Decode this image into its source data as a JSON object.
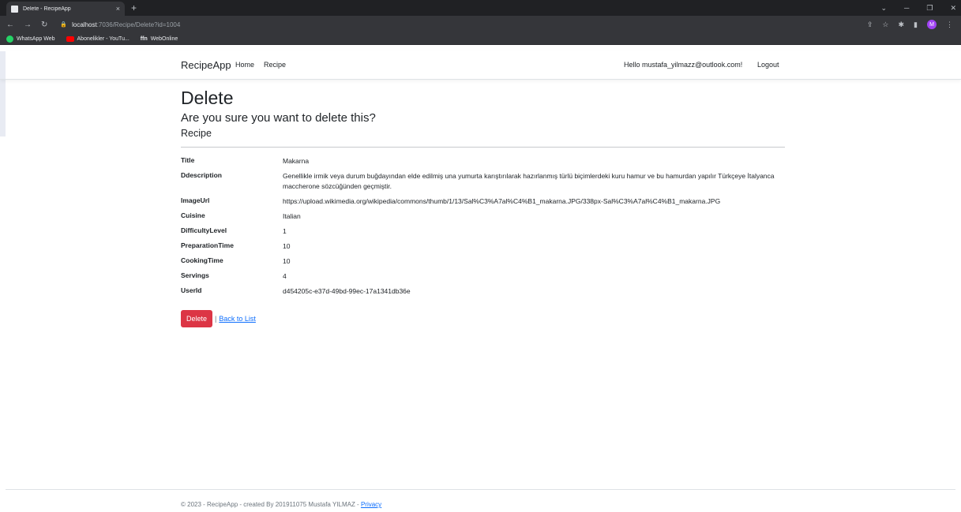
{
  "browser": {
    "tab_title": "Delete - RecipeApp",
    "tab_close": "×",
    "new_tab": "+",
    "url_host": "localhost",
    "url_path": ":7036/Recipe/Delete?id=1004",
    "bookmarks": [
      "WhatsApp Web",
      "Abonelikler - YouTu...",
      "WebOnline"
    ],
    "profile_initial": "M"
  },
  "navbar": {
    "brand": "RecipeApp",
    "home": "Home",
    "recipe": "Recipe",
    "hello": "Hello mustafa_yilmazz@outlook.com!",
    "logout": "Logout"
  },
  "main": {
    "title": "Delete",
    "confirm": "Are you sure you want to delete this?",
    "model": "Recipe",
    "details": [
      {
        "label": "Title",
        "value": "Makarna"
      },
      {
        "label": "Ddescription",
        "value": "Genellikle irmik veya durum buğdayından elde edilmiş una yumurta karıştırılarak hazırlanmış türlü biçimlerdeki kuru hamur ve bu hamurdan yapılır Türkçeye İtalyanca maccherone sözcüğünden geçmiştir."
      },
      {
        "label": "ImageUrl",
        "value": "https://upload.wikimedia.org/wikipedia/commons/thumb/1/13/Sal%C3%A7al%C4%B1_makarna.JPG/338px-Sal%C3%A7al%C4%B1_makarna.JPG"
      },
      {
        "label": "Cuisine",
        "value": "Italian"
      },
      {
        "label": "DifficultyLevel",
        "value": "1"
      },
      {
        "label": "PreparationTime",
        "value": "10"
      },
      {
        "label": "CookingTime",
        "value": "10"
      },
      {
        "label": "Servings",
        "value": "4"
      },
      {
        "label": "UserId",
        "value": "d454205c-e37d-49bd-99ec-17a1341db36e"
      }
    ],
    "delete_button": "Delete",
    "separator": "|",
    "back_link": "Back to List"
  },
  "footer": {
    "text": "© 2023 - RecipeApp - created By 201911075 Mustafa YILMAZ - ",
    "privacy": "Privacy"
  }
}
